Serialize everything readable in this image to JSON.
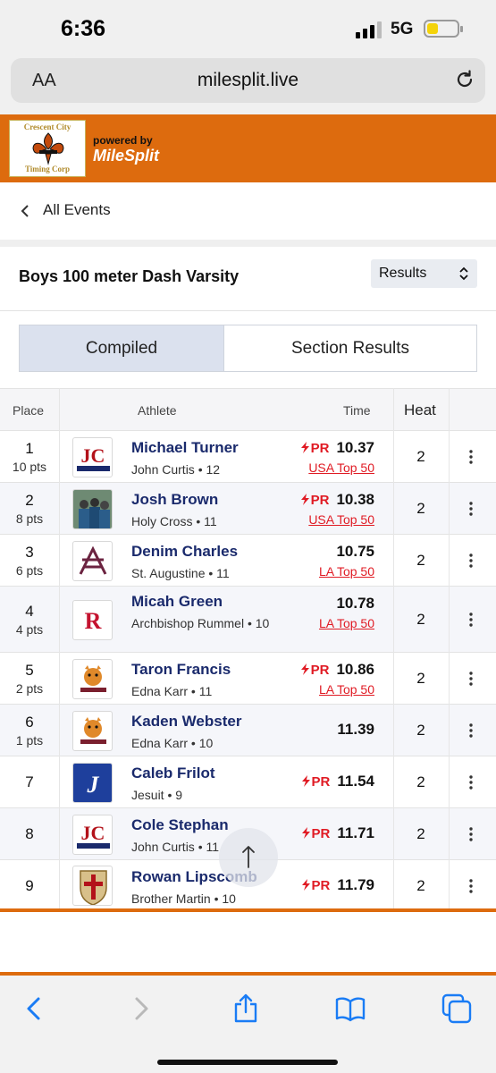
{
  "status": {
    "time": "6:36",
    "network": "5G"
  },
  "browser": {
    "text_size_label": "AA",
    "url": "milesplit.live"
  },
  "banner": {
    "logo_top": "Crescent City",
    "logo_bottom": "Timing Corp",
    "powered_by": "powered by",
    "brand": "MileSplit"
  },
  "nav": {
    "back_label": "All Events"
  },
  "event": {
    "title": "Boys 100 meter Dash Varsity",
    "view_select": "Results"
  },
  "tabs": [
    {
      "label": "Compiled",
      "active": true
    },
    {
      "label": "Section Results",
      "active": false
    }
  ],
  "table": {
    "headers": {
      "place": "Place",
      "athlete": "Athlete",
      "time": "Time",
      "heat": "Heat"
    },
    "rows": [
      {
        "place": "1",
        "pts": "10 pts",
        "name": "Michael Turner",
        "school": "John Curtis • 12",
        "pr": "PR",
        "time": "10.37",
        "rank": "USA Top 50",
        "heat": "2"
      },
      {
        "place": "2",
        "pts": "8 pts",
        "name": "Josh Brown",
        "school": "Holy Cross • 11",
        "pr": "PR",
        "time": "10.38",
        "rank": "USA Top 50",
        "heat": "2"
      },
      {
        "place": "3",
        "pts": "6 pts",
        "name": "Denim Charles",
        "school": "St. Augustine • 11",
        "pr": "",
        "time": "10.75",
        "rank": "LA Top 50",
        "heat": "2"
      },
      {
        "place": "4",
        "pts": "4 pts",
        "name": "Micah Green",
        "school": "Archbishop Rummel • 10",
        "pr": "",
        "time": "10.78",
        "rank": "LA Top 50",
        "heat": "2"
      },
      {
        "place": "5",
        "pts": "2 pts",
        "name": "Taron Francis",
        "school": "Edna Karr • 11",
        "pr": "PR",
        "time": "10.86",
        "rank": "LA Top 50",
        "heat": "2"
      },
      {
        "place": "6",
        "pts": "1 pts",
        "name": "Kaden Webster",
        "school": "Edna Karr • 10",
        "pr": "",
        "time": "11.39",
        "rank": "",
        "heat": "2"
      },
      {
        "place": "7",
        "pts": "",
        "name": "Caleb Frilot",
        "school": "Jesuit • 9",
        "pr": "PR",
        "time": "11.54",
        "rank": "",
        "heat": "2"
      },
      {
        "place": "8",
        "pts": "",
        "name": "Cole Stephan",
        "school": "John Curtis • 11",
        "pr": "PR",
        "time": "11.71",
        "rank": "",
        "heat": "2"
      },
      {
        "place": "9",
        "pts": "",
        "name": "Rowan Lipscomb",
        "school": "Brother Martin • 10",
        "pr": "PR",
        "time": "11.79",
        "rank": "",
        "heat": "2"
      }
    ]
  },
  "colors": {
    "brand_orange": "#dd6b0e",
    "pr_red": "#e01b24",
    "name_navy": "#1a2a6c",
    "ios_blue": "#1a7cf5"
  },
  "icons": [
    "reload-icon",
    "back-chevron-icon",
    "select-chevron-icon",
    "kebab-icon",
    "scroll-top-icon",
    "safari-back-icon",
    "safari-forward-icon",
    "share-icon",
    "bookmarks-icon",
    "tabs-icon"
  ]
}
